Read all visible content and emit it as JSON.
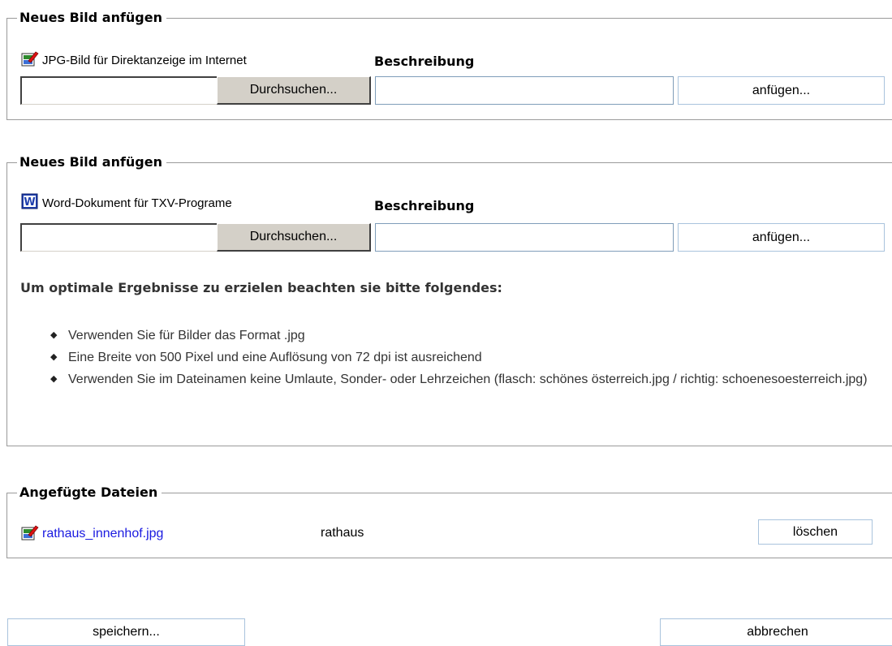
{
  "section1": {
    "legend": "Neues Bild anfügen",
    "type_label": "JPG-Bild für Direktanzeige im Internet",
    "type_icon": "jpg-image-icon",
    "description_label": "Beschreibung",
    "file_value": "",
    "browse_label": "Durchsuchen...",
    "description_value": "",
    "attach_label": "anfügen..."
  },
  "section2": {
    "legend": "Neues Bild anfügen",
    "type_label": "Word-Dokument für TXV-Programe",
    "type_icon": "word-document-icon",
    "description_label": "Beschreibung",
    "file_value": "",
    "browse_label": "Durchsuchen...",
    "description_value": "",
    "attach_label": "anfügen...",
    "hint_title": "Um optimale Ergebnisse zu erzielen beachten sie bitte folgendes:",
    "hints": [
      "Verwenden Sie für Bilder das Format .jpg",
      "Eine Breite von 500 Pixel und eine Auflösung von 72 dpi ist ausreichend",
      "Verwenden Sie im Dateinamen keine Umlaute, Sonder- oder Lehrzeichen (flasch: schönes österreich.jpg / richtig: schoenesoesterreich.jpg)"
    ]
  },
  "attached": {
    "legend": "Angefügte Dateien",
    "files": [
      {
        "name": "rathaus_innenhof.jpg",
        "icon": "jpg-image-icon",
        "description": "rathaus",
        "delete_label": "löschen"
      }
    ]
  },
  "footer": {
    "save_label": "speichern...",
    "cancel_label": "abbrechen"
  },
  "colors": {
    "link": "#1a1ae0",
    "button_border": "#a9c3dd",
    "fieldset_border": "#9a9a9a"
  }
}
